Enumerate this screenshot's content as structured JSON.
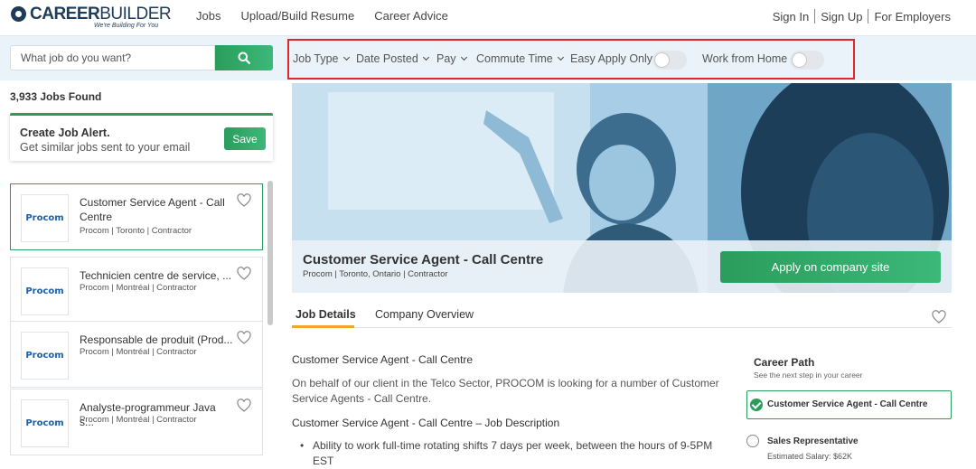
{
  "header": {
    "logo_text_bold": "CAREER",
    "logo_text_regular": "BUILDER",
    "logo_tagline": "We're Building For You",
    "nav": [
      "Jobs",
      "Upload/Build Resume",
      "Career Advice"
    ],
    "auth": [
      "Sign In",
      "Sign Up",
      "For Employers"
    ]
  },
  "search": {
    "placeholder": "What job do you want?",
    "button_icon": "search-icon"
  },
  "filters": {
    "job_type": "Job Type",
    "date_posted": "Date Posted",
    "pay": "Pay",
    "commute_time": "Commute Time",
    "easy_apply": "Easy Apply Only",
    "work_from_home": "Work from Home"
  },
  "results": {
    "count_label": "3,933 Jobs Found"
  },
  "job_alert": {
    "title": "Create Job Alert.",
    "subtitle": "Get similar jobs sent to your email",
    "save_label": "Save"
  },
  "jobs": [
    {
      "logo": "Procom",
      "title": "Customer Service Agent - Call Centre",
      "meta": "Procom | Toronto | Contractor"
    },
    {
      "logo": "Procom",
      "title": "Technicien centre de service, ...",
      "meta": "Procom | Montréal | Contractor"
    },
    {
      "logo": "Procom",
      "title": "Responsable de produit (Prod...",
      "meta": "Procom | Montréal | Contractor"
    },
    {
      "logo": "Procom",
      "title": "Analyste-programmeur Java s...",
      "meta": "Procom | Montréal | Contractor"
    }
  ],
  "detail": {
    "title": "Customer Service Agent - Call Centre",
    "meta": "Procom | Toronto, Ontario | Contractor",
    "apply_label": "Apply on company site",
    "tabs": [
      "Job Details",
      "Company Overview"
    ],
    "heading": "Customer Service Agent - Call Centre",
    "paragraph": "On behalf of our client in the Telco Sector, PROCOM is looking for a number of Customer Service Agents - Call Centre.",
    "subheading": "Customer Service Agent - Call Centre – Job Description",
    "bullet": "Ability to work full-time rotating shifts 7 days per week, between the hours of 9-5PM EST"
  },
  "career_path": {
    "title": "Career Path",
    "subtitle": "See the next step in your career",
    "current": "Customer Service Agent - Call Centre",
    "next": "Sales Representative",
    "salary": "Estimated Salary: $62K"
  },
  "colors": {
    "brand_navy": "#1f3b55",
    "accent_green": "#2a9d5c",
    "highlight_red": "#e3262b",
    "tab_underline": "#f0a62b"
  }
}
